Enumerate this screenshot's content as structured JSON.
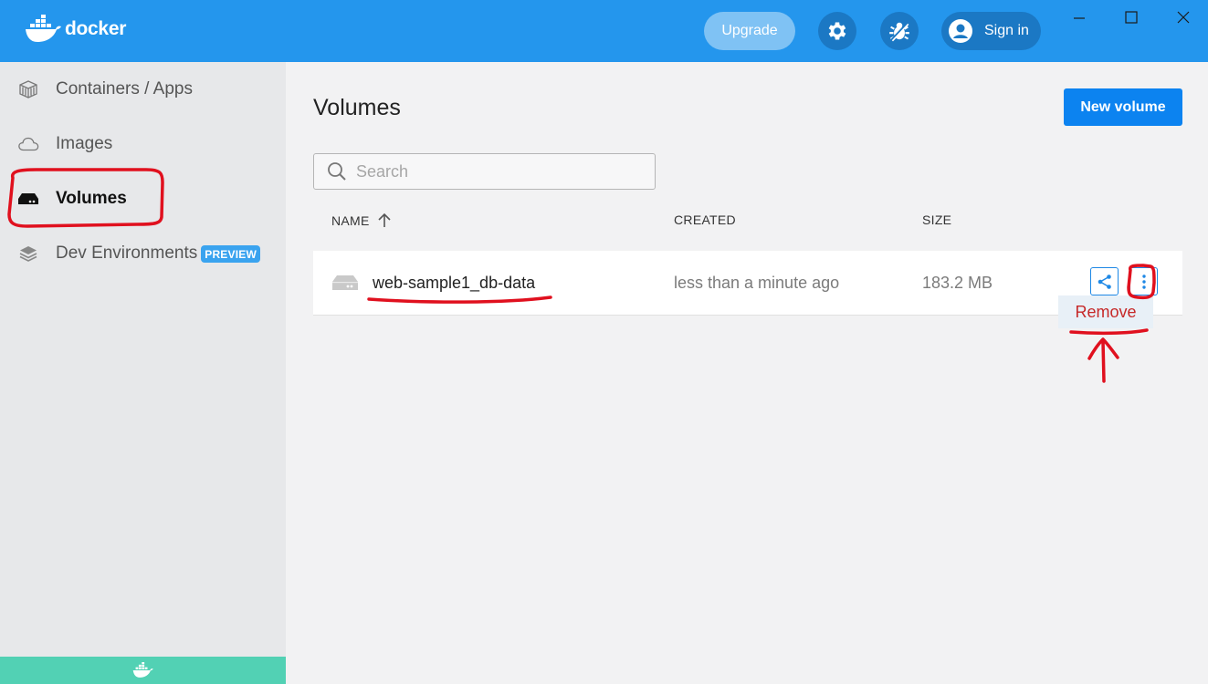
{
  "app": {
    "name": "docker",
    "brand_color": "#2496ed",
    "window_controls": [
      "minimize-icon",
      "maximize-icon",
      "close-icon"
    ]
  },
  "header": {
    "upgrade_label": "Upgrade",
    "signin_label": "Sign in",
    "icons": [
      "settings-gear-icon",
      "bug-report-icon",
      "user-avatar-icon"
    ]
  },
  "sidebar": {
    "items": [
      {
        "label": "Containers / Apps",
        "icon": "containers-icon",
        "active": false
      },
      {
        "label": "Images",
        "icon": "cloud-icon",
        "active": false
      },
      {
        "label": "Volumes",
        "icon": "disk-icon",
        "active": true
      },
      {
        "label": "Dev Environments",
        "icon": "layers-icon",
        "active": false,
        "badge": "PREVIEW"
      }
    ],
    "footer_color": "#52d1b4"
  },
  "main": {
    "title": "Volumes",
    "new_volume_label": "New volume",
    "search": {
      "placeholder": "Search",
      "value": ""
    },
    "table": {
      "columns": {
        "name": "NAME",
        "created": "CREATED",
        "size": "SIZE"
      },
      "sort": {
        "column": "NAME",
        "direction": "ascending"
      },
      "rows": [
        {
          "name": "web-sample1_db-data",
          "created": "less than a minute ago",
          "size": "183.2 MB"
        }
      ]
    },
    "row_menu": {
      "open": true,
      "items": [
        "Remove"
      ]
    }
  },
  "annotations": {
    "color": "#e0101e"
  }
}
